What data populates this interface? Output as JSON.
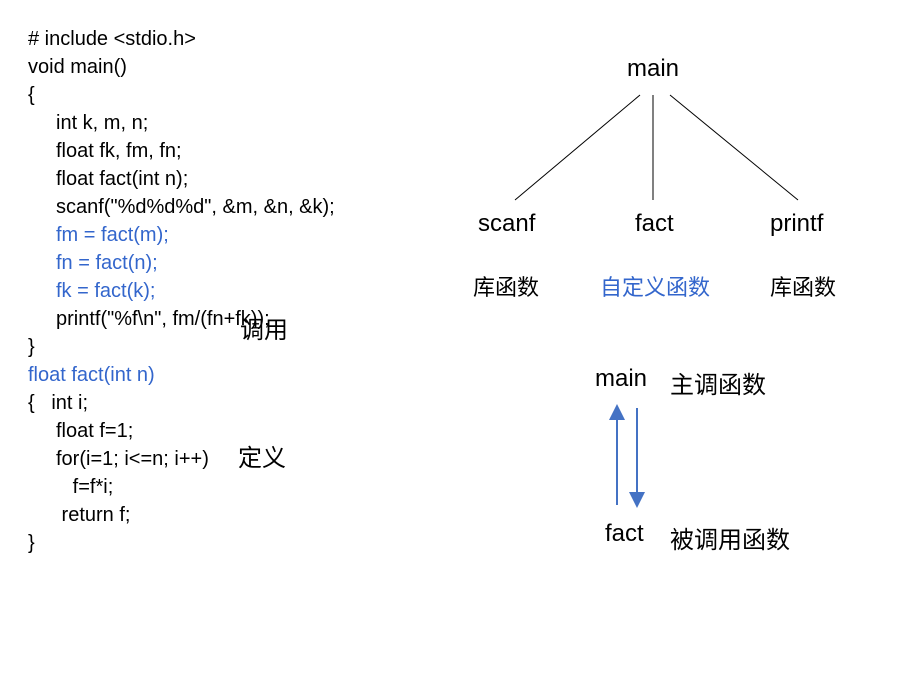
{
  "code": {
    "l1": "# include <stdio.h>",
    "l2": "void main()",
    "l3": "{",
    "l4": "int k, m, n;",
    "l5": "float fk, fm, fn;",
    "l6": "float fact(int n);",
    "l7": "",
    "l8": "scanf(\"%d%d%d\", &m, &n, &k);",
    "l9": "fm = fact(m);",
    "l10": "fn = fact(n);",
    "l11": "fk = fact(k);",
    "l12": "printf(\"%f\\n\", fm/(fn+fk));",
    "l13": "}",
    "l14": "float fact(int n)",
    "l15": "{   int i;",
    "l16": "float f=1;",
    "l17": "",
    "l18": "for(i=1; i<=n; i++)",
    "l19": "   f=f*i;",
    "l20": " return f;",
    "l21": "}"
  },
  "annotations": {
    "call": "调用",
    "define": "定义"
  },
  "tree": {
    "root": "main",
    "left": "scanf",
    "mid": "fact",
    "right": "printf",
    "left_caption": "库函数",
    "mid_caption": "自定义函数",
    "right_caption": "库函数"
  },
  "relation": {
    "top": "main",
    "top_caption": "主调函数",
    "bottom": "fact",
    "bottom_caption": "被调用函数"
  }
}
